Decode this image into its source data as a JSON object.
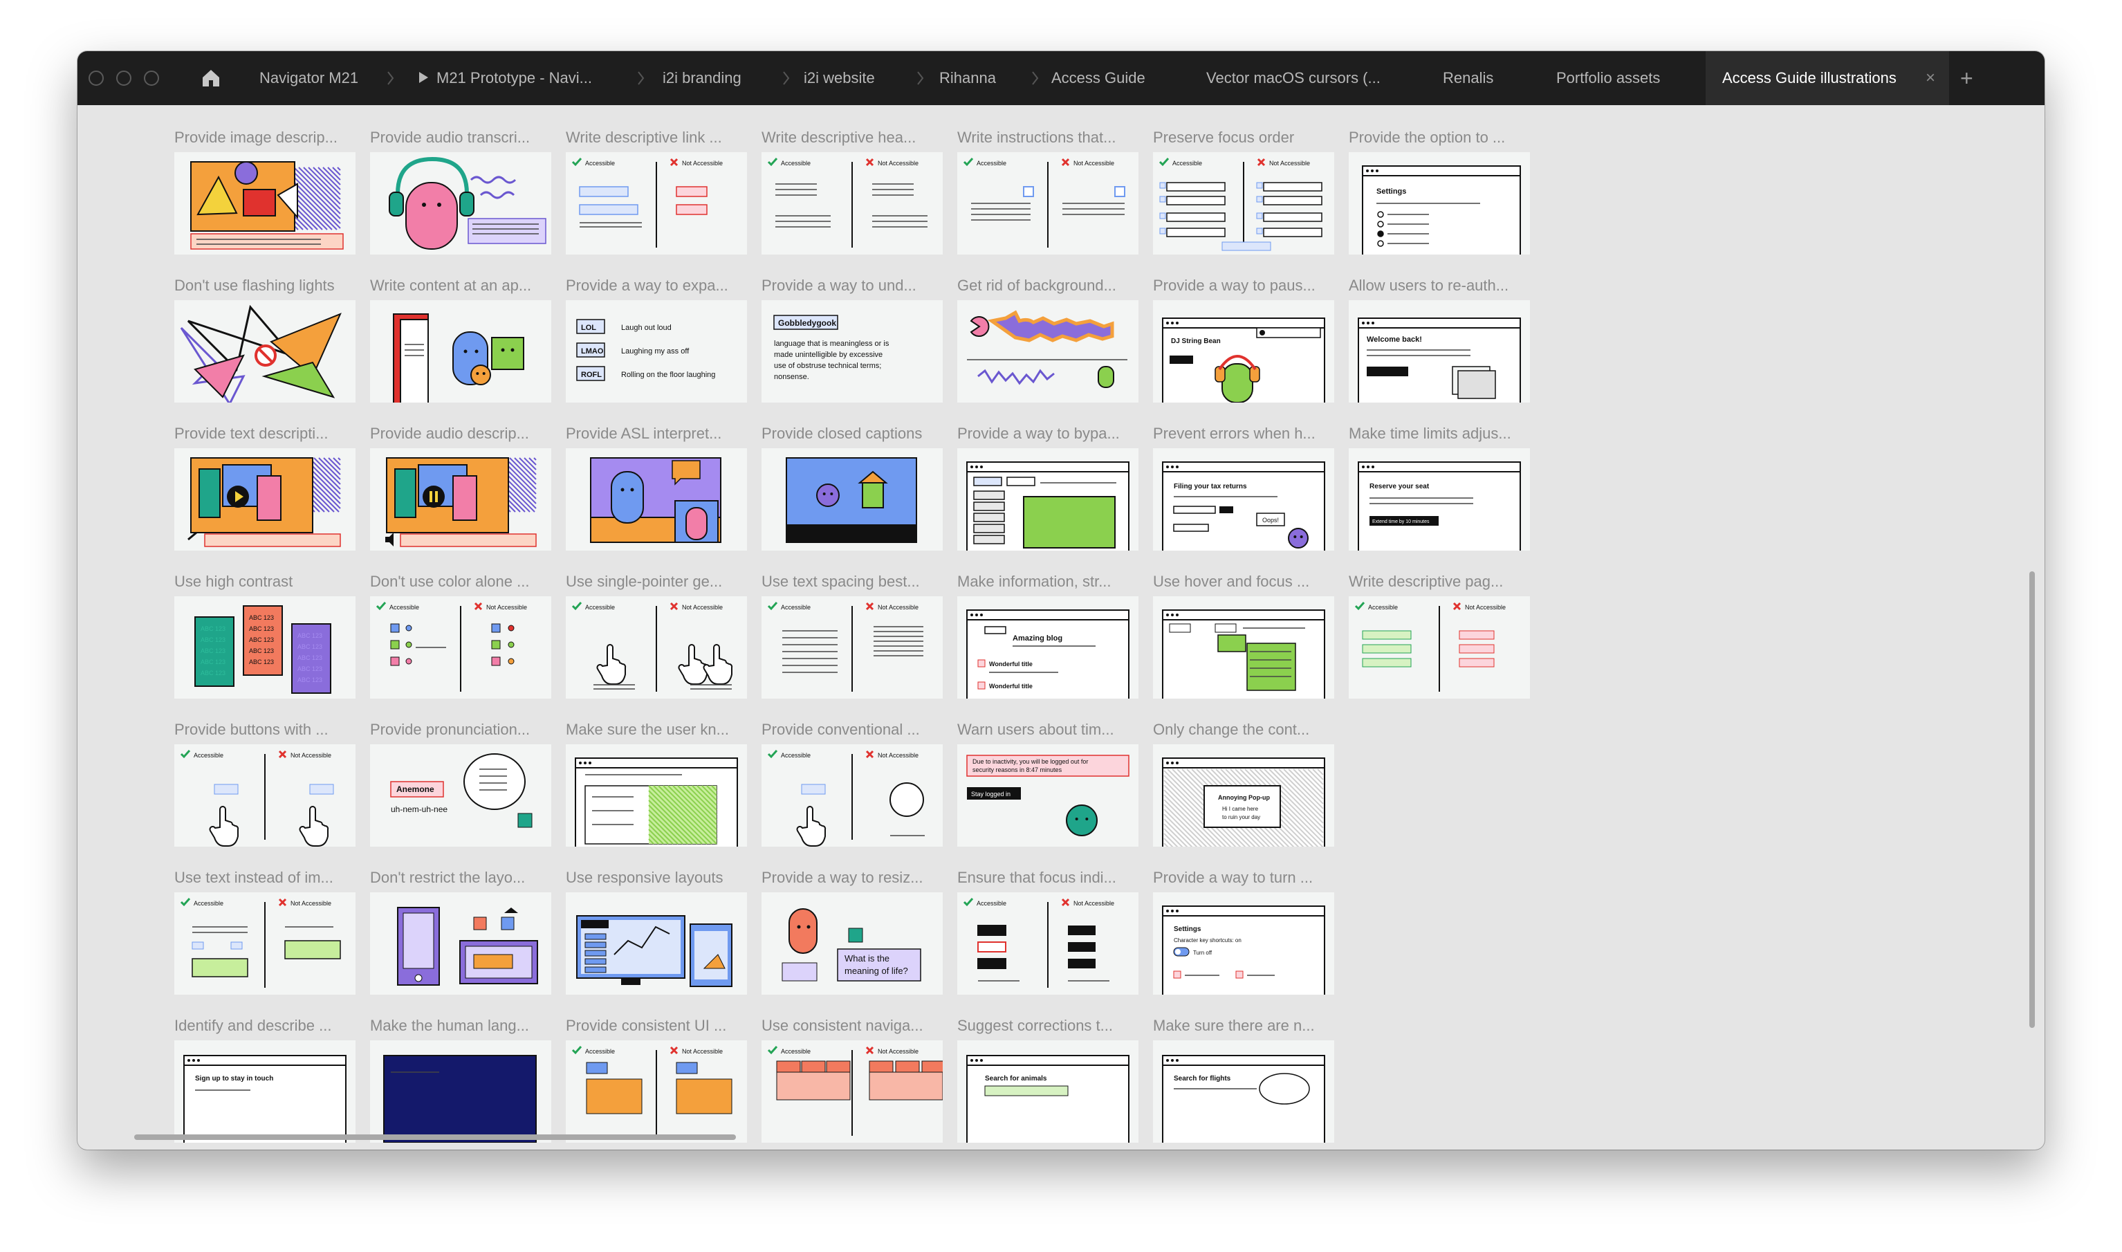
{
  "tabs": [
    {
      "label": "Navigator M21"
    },
    {
      "label": "M21 Prototype - Navi..."
    },
    {
      "label": "i2i branding"
    },
    {
      "label": "i2i website"
    },
    {
      "label": "Rihanna"
    },
    {
      "label": "Access Guide"
    },
    {
      "label": "Vector macOS cursors (..."
    },
    {
      "label": "Renalis"
    },
    {
      "label": "Portfolio assets"
    },
    {
      "label": "Access Guide illustrations",
      "active": true
    }
  ],
  "tab_close_symbol": "×",
  "tab_add_symbol": "+",
  "icons": [
    "home-icon",
    "play-icon",
    "close-icon",
    "plus-icon"
  ],
  "colors": {
    "tabbar": "#1e1e1e",
    "canvas": "#e5e5e5",
    "thumbnail": "#f3f5f4",
    "accent_green": "#8bd04e",
    "accent_orange": "#f4a03c",
    "accent_pink": "#f27ea8",
    "accent_purple": "#8a6ddb",
    "accent_teal": "#1fa58a",
    "accent_blue": "#6f9af0"
  },
  "grid": [
    [
      "Provide image descrip...",
      "Provide audio transcri...",
      "Write descriptive link ...",
      "Write descriptive hea...",
      "Write instructions that...",
      "Preserve focus order",
      "Provide the option to ..."
    ],
    [
      "Don't use flashing lights",
      "Write content at an ap...",
      "Provide a way to expa...",
      "Provide a way to und...",
      "Get rid of background...",
      "Provide a way to paus...",
      "Allow users to re-auth..."
    ],
    [
      "Provide text descripti...",
      "Provide audio descrip...",
      "Provide ASL interpret...",
      "Provide closed captions",
      "Provide a way to bypa...",
      "Prevent errors when h...",
      "Make time limits adjus..."
    ],
    [
      "Use high contrast",
      "Don't use color alone ...",
      "Use single-pointer ge...",
      "Use text spacing best...",
      "Make information, str...",
      "Use hover and focus ...",
      "Write descriptive pag..."
    ],
    [
      "Provide buttons with ...",
      "Provide pronunciation...",
      "Make sure the user kn...",
      "Provide conventional ...",
      "Warn users about tim...",
      "Only change the cont..."
    ],
    [
      "Use text instead of im...",
      "Don't restrict the layo...",
      "Use responsive layouts",
      "Provide a way to resiz...",
      "Ensure that focus indi...",
      "Provide a way to turn ..."
    ],
    [
      "Identify and describe ...",
      "Make the human lang...",
      "Provide consistent UI ...",
      "Use consistent naviga...",
      "Suggest corrections t...",
      "Make sure there are n..."
    ]
  ],
  "thumbs": {
    "accessible": "Accessible",
    "not_accessible": "Not Accessible",
    "settings": "Settings",
    "lol": [
      "LOL",
      "LMAO",
      "ROFL"
    ],
    "lol_text": [
      "Laugh out loud",
      "Laughing my ass off",
      "Rolling on the floor laughing"
    ],
    "gobbledygook": "Gobbledygook",
    "gobbledygook_text": [
      "language that is meaningless or is",
      "made unintelligible by excessive",
      "use of obstruse technical terms;",
      "nonsense."
    ],
    "abc": "ABC 123",
    "amazing_blog": "Amazing blog",
    "wonderful_title": "Wonderful title",
    "anemone": "Anemone",
    "anemone_say": "uh-nem-uh-nee",
    "what_meaning": [
      "What is the",
      "meaning of life?"
    ],
    "stay_logged_in": "Stay logged in",
    "timeout_warning": "Due to inactivity, you will be logged out for security reasons in 8:47 minutes",
    "welcome_back": "Welcome back!",
    "reserve_seat": "Reserve your seat",
    "extend_time": "Extend time by 10 minutes",
    "filing_taxes": "Filing your tax returns",
    "oops": "Oops!",
    "dj": "DJ String Bean",
    "sign_up": "Sign up to stay in touch",
    "search_animals": "Search for animals",
    "search_flights": "Search for flights",
    "settings_sub": "Character key shortcuts: on",
    "turn_off": "Turn off",
    "annoying_popup": "Annoying Pop-up",
    "hi_popup": "Hi I came here to ruin your day"
  }
}
